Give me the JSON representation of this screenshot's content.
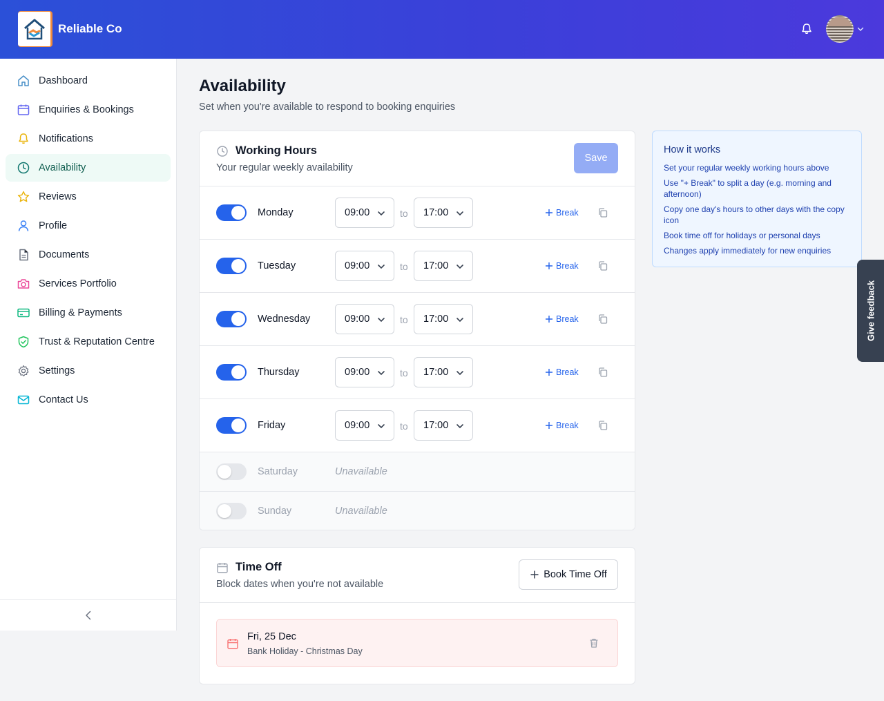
{
  "header": {
    "brand": "Reliable Co"
  },
  "sidebar": {
    "items": [
      {
        "label": "Dashboard",
        "icon": "home-icon"
      },
      {
        "label": "Enquiries & Bookings",
        "icon": "calendar-icon"
      },
      {
        "label": "Notifications",
        "icon": "bell-icon"
      },
      {
        "label": "Availability",
        "icon": "clock-icon",
        "active": true
      },
      {
        "label": "Reviews",
        "icon": "star-icon"
      },
      {
        "label": "Profile",
        "icon": "user-icon"
      },
      {
        "label": "Documents",
        "icon": "document-icon"
      },
      {
        "label": "Services Portfolio",
        "icon": "camera-icon"
      },
      {
        "label": "Billing & Payments",
        "icon": "credit-card-icon"
      },
      {
        "label": "Trust & Reputation Centre",
        "icon": "shield-check-icon"
      },
      {
        "label": "Settings",
        "icon": "gear-icon"
      },
      {
        "label": "Contact Us",
        "icon": "mail-icon"
      }
    ]
  },
  "page": {
    "title": "Availability",
    "subtitle": "Set when you're available to respond to booking enquiries"
  },
  "working_hours": {
    "title": "Working Hours",
    "subtitle": "Your regular weekly availability",
    "save_label": "Save",
    "to_label": "to",
    "break_label": "Break",
    "unavailable_label": "Unavailable",
    "days": [
      {
        "name": "Monday",
        "enabled": true,
        "start": "09:00",
        "end": "17:00"
      },
      {
        "name": "Tuesday",
        "enabled": true,
        "start": "09:00",
        "end": "17:00"
      },
      {
        "name": "Wednesday",
        "enabled": true,
        "start": "09:00",
        "end": "17:00"
      },
      {
        "name": "Thursday",
        "enabled": true,
        "start": "09:00",
        "end": "17:00"
      },
      {
        "name": "Friday",
        "enabled": true,
        "start": "09:00",
        "end": "17:00"
      },
      {
        "name": "Saturday",
        "enabled": false
      },
      {
        "name": "Sunday",
        "enabled": false
      }
    ]
  },
  "time_off": {
    "title": "Time Off",
    "subtitle": "Block dates when you're not available",
    "book_label": "Book Time Off",
    "entries": [
      {
        "date": "Fri, 25 Dec",
        "reason": "Bank Holiday - Christmas Day"
      }
    ]
  },
  "how_it_works": {
    "title": "How it works",
    "tips": [
      "Set your regular weekly working hours above",
      "Use \"+ Break\" to split a day (e.g. morning and afternoon)",
      "Copy one day's hours to other days with the copy icon",
      "Book time off for holidays or personal days",
      "Changes apply immediately for new enquiries"
    ]
  },
  "feedback": {
    "label": "Give feedback"
  },
  "colors": {
    "primary": "#2563eb",
    "active_nav": "#eefaf6",
    "save_disabled": "#94acf5",
    "feedback_bg": "#374151"
  }
}
